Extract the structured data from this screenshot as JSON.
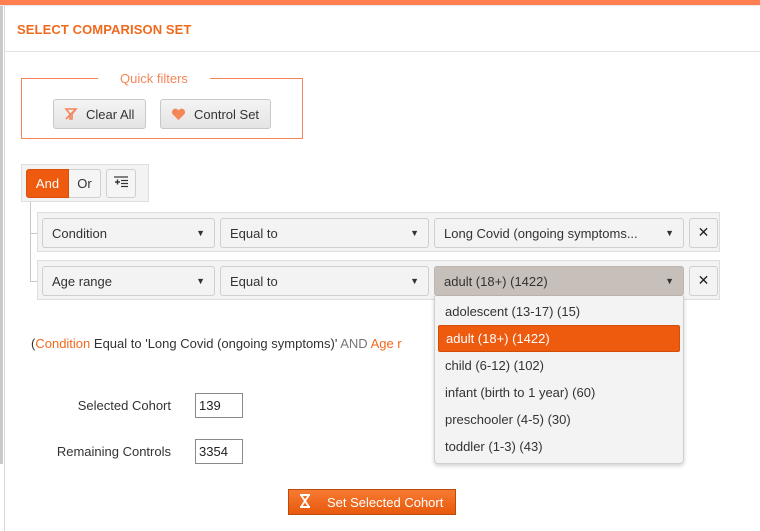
{
  "header": {
    "title": "SELECT COMPARISON SET"
  },
  "quick_filters": {
    "legend": "Quick filters",
    "buttons": [
      {
        "label": "Clear All",
        "icon": "clear-filter-icon"
      },
      {
        "label": "Control Set",
        "icon": "heart-icon"
      }
    ]
  },
  "query_builder": {
    "conjunctions": [
      {
        "label": "And",
        "active": true
      },
      {
        "label": "Or",
        "active": false
      }
    ],
    "add_rule_icon": "add-rule-icon",
    "rules": [
      {
        "field": "Condition",
        "operator": "Equal to",
        "value": "Long Covid (ongoing symptoms..."
      },
      {
        "field": "Age range",
        "operator": "Equal to",
        "value": "adult (18+) (1422)"
      }
    ],
    "value_dropdown": {
      "options": [
        "adolescent (13-17) (15)",
        "adult (18+) (1422)",
        "child (6-12) (102)",
        "infant (birth to 1 year) (60)",
        "preschooler (4-5) (30)",
        "toddler (1-3) (43)"
      ],
      "selected": "adult (18+) (1422)"
    }
  },
  "summary": {
    "open_paren": "(",
    "field1": "Condition",
    "text1": " Equal to 'Long Covid (ongoing symptoms)' ",
    "conj": "AND",
    "field2": " Age r"
  },
  "cohort": {
    "selected_label": "Selected Cohort",
    "selected_value": "139",
    "remaining_label": "Remaining Controls",
    "remaining_value": "3354"
  },
  "actions": {
    "set_cohort_label": "Set Selected Cohort"
  },
  "colors": {
    "accent": "#ee5a0e",
    "accent_light": "#f4865a",
    "top_bar": "#ff7f50"
  }
}
